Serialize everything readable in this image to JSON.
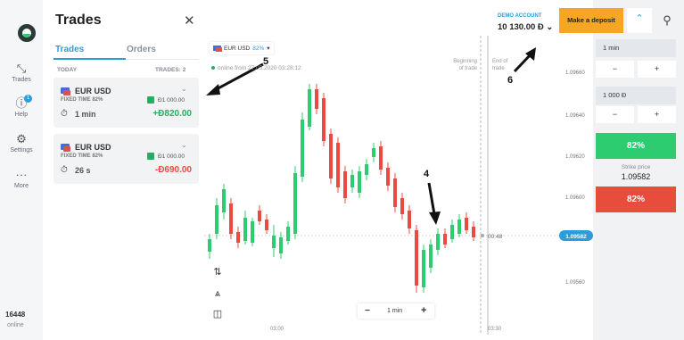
{
  "rail": {
    "items": [
      {
        "label": "Trades",
        "icon": "expand-arrows-icon"
      },
      {
        "label": "Help",
        "icon": "help-icon",
        "badge": "1"
      },
      {
        "label": "Settings",
        "icon": "gear-icon"
      },
      {
        "label": "More",
        "icon": "more-dots-icon"
      }
    ],
    "online_count": "16448",
    "online_label": "online"
  },
  "panel": {
    "title": "Trades",
    "tabs": [
      "Trades",
      "Orders"
    ],
    "list_header_left": "TODAY",
    "list_header_right": "TRADES: 2",
    "cards": [
      {
        "pair": "EUR USD",
        "fixed_time": "FIXED TIME 82%",
        "investment": "Đ1 000.00",
        "timer": "1 min",
        "profit": "+Đ820.00",
        "profit_color": "#27ae60"
      },
      {
        "pair": "EUR USD",
        "fixed_time": "FIXED TIME 82%",
        "investment": "Đ1 000.00",
        "timer": "26 s",
        "profit": "-Đ690.00",
        "profit_color": "#e74c3c"
      }
    ]
  },
  "chart": {
    "asset": "EUR USD",
    "asset_pct": "82%",
    "online_since": "online from 27.05.2020 03:28:12",
    "beginning_label": [
      "Beginning",
      "of trade"
    ],
    "end_label": [
      "End of",
      "trade"
    ],
    "timer_label": "00:48",
    "current_price": "1.09582",
    "price_ticks": [
      "1.09660",
      "1.09640",
      "1.09620",
      "1.09600",
      "1.09560"
    ],
    "time_ticks": [
      "03:00",
      "03:30"
    ],
    "zoom_value": "1 min",
    "zoom_minus": "−",
    "zoom_plus": "+",
    "annotations": [
      "5",
      "6",
      "4"
    ]
  },
  "account": {
    "demo_label": "DEMO ACCOUNT",
    "balance": "10 130.00 Đ ⌄"
  },
  "controls": {
    "deposit_label": "Make a deposit",
    "duration": "1 min",
    "amount": "1 000 Đ",
    "minus": "−",
    "plus": "+",
    "up_label": "82%",
    "strike_label": "Strike price",
    "strike_value": "1.09582",
    "down_label": "82%"
  },
  "colors": {
    "up": "#2ecc71",
    "down": "#e74c3c",
    "accent": "#2d9cdb",
    "deposit": "#f5a623"
  }
}
